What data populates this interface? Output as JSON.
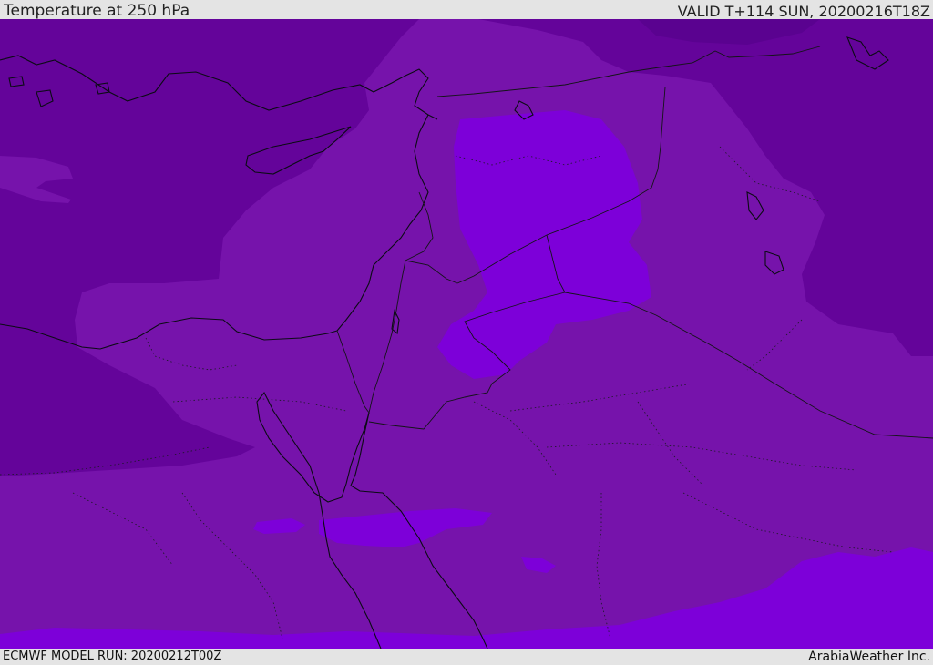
{
  "header": {
    "title": "Temperature at 250 hPa",
    "valid": "VALID T+114 SUN, 20200216T18Z"
  },
  "footer": {
    "model_run": "ECMWF MODEL RUN: 20200212T00Z",
    "credit": "ArabiaWeather Inc."
  },
  "map": {
    "variable": "temperature",
    "level": "250 hPa",
    "colors": {
      "coldest": "#64049a",
      "mid": "#7613ab",
      "warm": "#7d00d9",
      "coastline": "#0b0b14",
      "border": "#141418"
    }
  }
}
